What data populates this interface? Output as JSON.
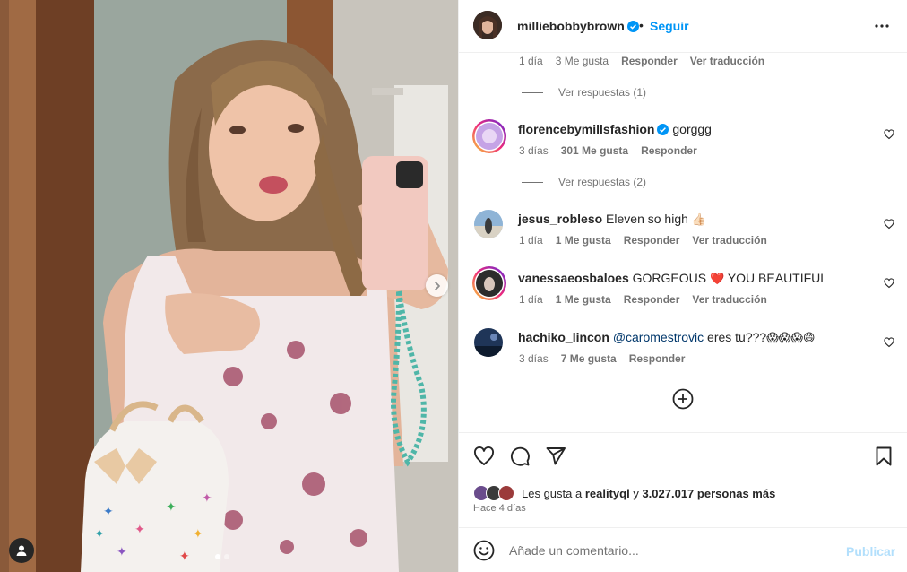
{
  "header": {
    "username": "milliebobbybrown",
    "separator": "•",
    "follow_label": "Seguir"
  },
  "comments": {
    "top_meta": {
      "time": "1 día",
      "likes": "3 Me gusta",
      "reply": "Responder",
      "translate": "Ver traducción"
    },
    "top_replies": "Ver respuestas (1)",
    "items": [
      {
        "username": "florencebymillsfashion",
        "text": "gorggg",
        "time": "3 días",
        "likes": "301 Me gusta",
        "reply": "Responder",
        "replies": "Ver respuestas (2)"
      },
      {
        "username": "jesus_robleso",
        "text": "Eleven so high",
        "emoji": "👍🏻",
        "time": "1 día",
        "likes": "1 Me gusta",
        "reply": "Responder",
        "translate": "Ver traducción"
      },
      {
        "username": "vanessaeosbaloes",
        "text": "GORGEOUS",
        "emoji": "❤️",
        "text2": "YOU BEAUTIFUL",
        "time": "1 día",
        "likes": "1 Me gusta",
        "reply": "Responder",
        "translate": "Ver traducción"
      },
      {
        "username": "hachiko_lincon",
        "mention": "@caromestrovic",
        "text": "eres tu???",
        "emoji": "😱😱😱😄",
        "time": "3 días",
        "likes": "7 Me gusta",
        "reply": "Responder"
      }
    ]
  },
  "likes": {
    "prefix": "Les gusta a",
    "user": "realityql",
    "connector": "y",
    "count": "3.027.017 personas más",
    "posted_ago": "Hace 4 días"
  },
  "composer": {
    "placeholder": "Añade un comentario...",
    "post_label": "Publicar"
  },
  "colors": {
    "accent": "#0095f6",
    "post_disabled": "#b2dffc",
    "heart_red": "#e0203f",
    "secondary_text": "#737373"
  },
  "icons": [
    "verified-badge-icon",
    "more-options-icon",
    "heart-icon",
    "comment-icon",
    "share-icon",
    "bookmark-icon",
    "add-circle-icon",
    "emoji-icon",
    "chevron-right-icon",
    "user-tag-icon"
  ],
  "carousel": {
    "total": 2,
    "current": 1
  }
}
